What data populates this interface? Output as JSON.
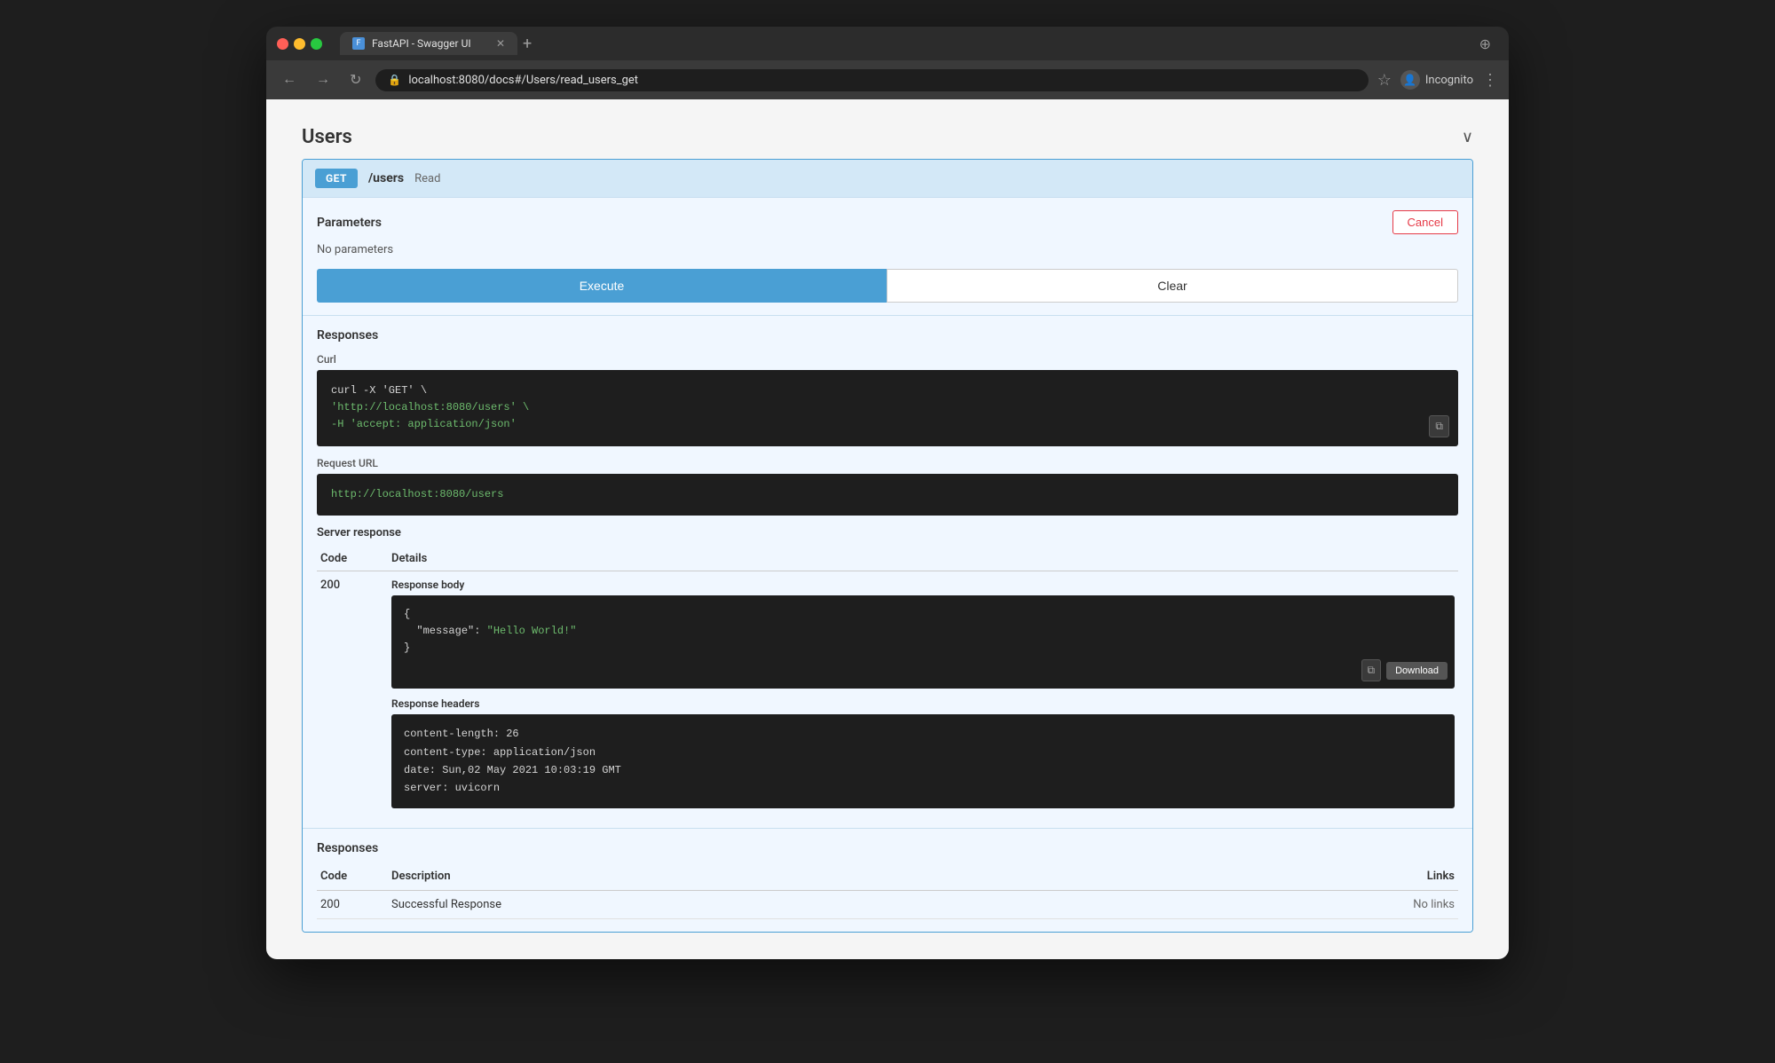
{
  "browser": {
    "tab_title": "FastAPI - Swagger UI",
    "url": "localhost:8080/docs#/Users/read_users_get",
    "incognito_label": "Incognito"
  },
  "section": {
    "title": "Users",
    "chevron": "∨"
  },
  "endpoint": {
    "method": "GET",
    "path": "/users",
    "description": "Read"
  },
  "parameters": {
    "title": "Parameters",
    "no_params_text": "No parameters",
    "cancel_label": "Cancel"
  },
  "actions": {
    "execute_label": "Execute",
    "clear_label": "Clear"
  },
  "responses_section": {
    "title": "Responses"
  },
  "curl_section": {
    "label": "Curl",
    "code_line1": "curl -X 'GET' \\",
    "code_line2": "  'http://localhost:8080/users' \\",
    "code_line3": "  -H 'accept: application/json'"
  },
  "request_url_section": {
    "label": "Request URL",
    "url": "http://localhost:8080/users"
  },
  "server_response": {
    "label": "Server response",
    "code_col": "Code",
    "details_col": "Details",
    "code_value": "200",
    "response_body_label": "Response body",
    "response_body_code": "{\n  \"message\": \"Hello World!\"\n}",
    "response_body_message_key": "\"message\"",
    "response_body_message_val": "\"Hello World!\"",
    "download_label": "Download",
    "response_headers_label": "Response headers",
    "response_headers_content_length": "content-length: 26",
    "response_headers_content_type": "content-type: application/json",
    "response_headers_date": "date: Sun,02 May 2021 10:03:19 GMT",
    "response_headers_server": "server: uvicorn"
  },
  "responses_table": {
    "title": "Responses",
    "code_col": "Code",
    "description_col": "Description",
    "links_col": "Links",
    "row_code": "200",
    "row_description": "Successful Response",
    "row_links": "No links"
  },
  "icons": {
    "back": "←",
    "forward": "→",
    "reload": "↻",
    "lock": "🔒",
    "star": "☆",
    "menu": "⋮",
    "copy": "⧉",
    "copy2": "⧉"
  }
}
